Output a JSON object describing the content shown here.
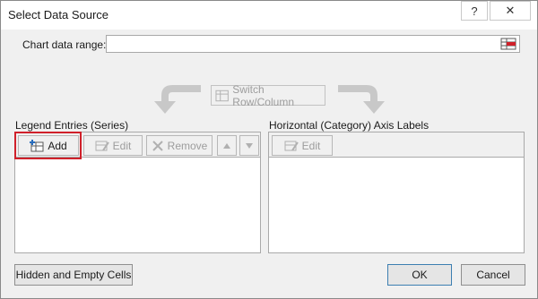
{
  "window": {
    "title": "Select Data Source",
    "help_glyph": "?",
    "close_glyph": "✕"
  },
  "range": {
    "label": "Chart data range:",
    "value": ""
  },
  "switch": {
    "label": "Switch Row/Column"
  },
  "legend": {
    "title": "Legend Entries (Series)",
    "add_label": "Add",
    "edit_label": "Edit",
    "remove_label": "Remove",
    "items": []
  },
  "axis": {
    "title": "Horizontal (Category) Axis Labels",
    "edit_label": "Edit",
    "items": []
  },
  "footer": {
    "hidden_empty_label": "Hidden and Empty Cells",
    "ok_label": "OK",
    "cancel_label": "Cancel"
  },
  "colors": {
    "highlight": "#d0202a",
    "disabled_text": "#9d9d9d"
  }
}
